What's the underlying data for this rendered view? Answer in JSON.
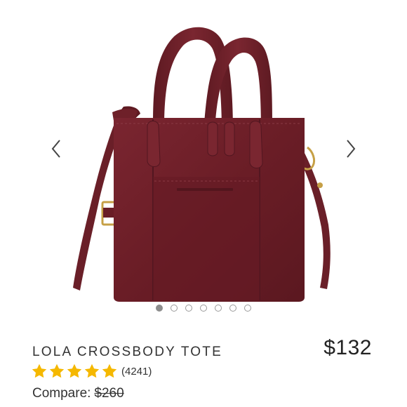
{
  "product": {
    "title": "LOLA CROSSBODY TOTE",
    "price": "$132",
    "rating": {
      "stars": 5,
      "max": 5,
      "count_text": "(4241)",
      "star_color": "#f5b800"
    },
    "compare": {
      "label": "Compare:",
      "original_price": "$260"
    },
    "bag_color": "#6e1f26"
  },
  "gallery": {
    "total_images": 7,
    "active_index": 0,
    "prev_icon": "chevron-left-icon",
    "next_icon": "chevron-right-icon"
  }
}
